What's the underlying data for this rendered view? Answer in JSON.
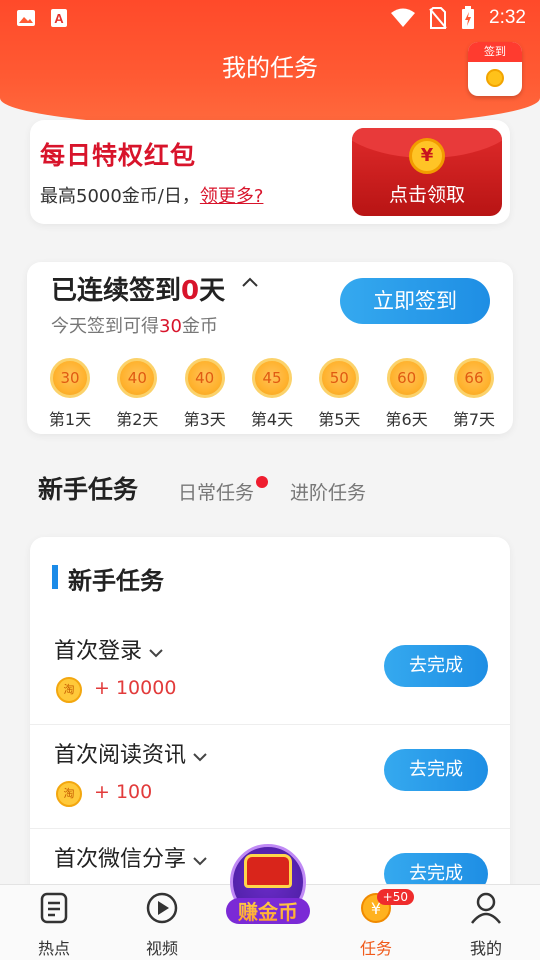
{
  "status_bar": {
    "time": "2:32",
    "icons": [
      "image-icon",
      "app-a-icon",
      "wifi-icon",
      "no-sim-icon",
      "battery-charging-icon"
    ]
  },
  "header": {
    "title": "我的任务",
    "signin_icon_label": "签到",
    "signin_icon_coin": "淘"
  },
  "privilege_card": {
    "title": "每日特权红包",
    "subtitle": "最高5000金币/日，",
    "more_link": "领更多?",
    "envelope_symbol": "¥",
    "claim_label": "点击领取"
  },
  "checkin": {
    "prefix": "已连续签到",
    "days": "0",
    "suffix": "天",
    "caret": "^",
    "today_prefix": "今天签到可得",
    "today_amount": "30",
    "today_suffix": "金币",
    "button_label": "立即签到",
    "rewards": [
      {
        "value": "30",
        "label": "第1天"
      },
      {
        "value": "40",
        "label": "第2天"
      },
      {
        "value": "40",
        "label": "第3天"
      },
      {
        "value": "45",
        "label": "第4天"
      },
      {
        "value": "50",
        "label": "第5天"
      },
      {
        "value": "60",
        "label": "第6天"
      },
      {
        "value": "66",
        "label": "第7天"
      }
    ]
  },
  "tabs": {
    "active": "新手任务",
    "daily": "日常任务",
    "advanced": "进阶任务"
  },
  "task_section": {
    "title": "新手任务",
    "coin_symbol": "淘",
    "tasks": [
      {
        "name": "首次登录",
        "reward": "+ 10000",
        "action": "去完成"
      },
      {
        "name": "首次阅读资讯",
        "reward": "+ 100",
        "action": "去完成"
      },
      {
        "name": "首次微信分享",
        "reward": "",
        "action": "去完成"
      }
    ]
  },
  "floating_badge": {
    "text": "赚金币"
  },
  "bottom_nav": {
    "items": [
      {
        "label": "热点",
        "icon": "news-icon"
      },
      {
        "label": "视频",
        "icon": "play-icon"
      },
      {
        "label": "任务",
        "icon": "coin-icon",
        "badge": "+50"
      },
      {
        "label": "我的",
        "icon": "profile-icon"
      }
    ]
  },
  "colors": {
    "header": "#ff4a2a",
    "accent_red": "#d8142b",
    "button_blue": "#1e8ee4",
    "active_tab": "#f05a1a"
  }
}
